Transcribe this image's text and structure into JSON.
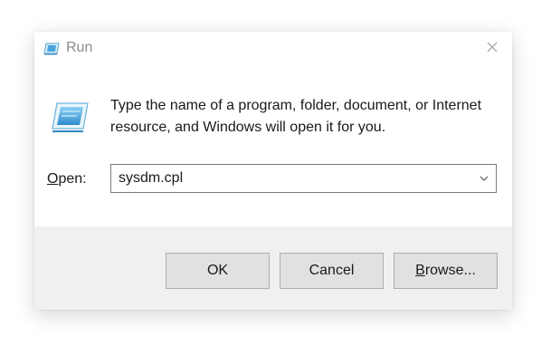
{
  "window": {
    "title": "Run",
    "title_icon": "run-icon",
    "close_icon": "close-icon"
  },
  "content": {
    "icon": "run-icon",
    "description": "Type the name of a program, folder, document, or Internet resource, and Windows will open it for you.",
    "open_label_accel": "O",
    "open_label_rest": "pen:",
    "input_value": "sysdm.cpl",
    "dropdown_icon": "chevron-down-icon"
  },
  "buttons": {
    "ok": "OK",
    "cancel": "Cancel",
    "browse_accel": "B",
    "browse_rest": "rowse..."
  },
  "colors": {
    "dialog_bg": "#ffffff",
    "footer_bg": "#f0f0f0",
    "button_bg": "#e1e1e1",
    "button_border": "#adadad",
    "title_text": "#8a8a8a"
  }
}
